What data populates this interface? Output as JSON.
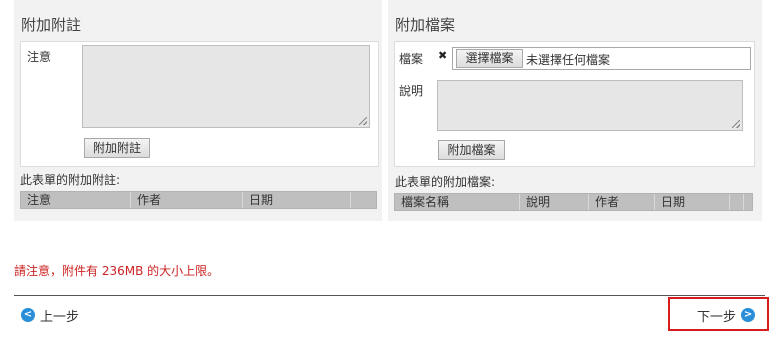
{
  "notes": {
    "title": "附加附註",
    "note_label": "注意",
    "note_value": "",
    "add_button": "附加附註",
    "list_title": "此表單的附加附註:",
    "columns": [
      "注意",
      "作者",
      "日期"
    ]
  },
  "files": {
    "title": "附加檔案",
    "file_label": "檔案",
    "remove_glyph": "✖",
    "choose_button": "選擇檔案",
    "no_file_text": "未選擇任何檔案",
    "desc_label": "說明",
    "desc_value": "",
    "add_button": "附加檔案",
    "list_title": "此表單的附加檔案:",
    "columns": [
      "檔案名稱",
      "說明",
      "作者",
      "日期"
    ]
  },
  "notice": "請注意，附件有 236MB 的大小上限。",
  "nav": {
    "prev_label": "上一步",
    "next_label": "下一步",
    "prev_icon": "chevron-left-circle",
    "next_icon": "chevron-right-circle"
  },
  "colors": {
    "notice": "#cc2222",
    "nav_icon": "#2a8fd8",
    "highlight": "#d81b1b"
  }
}
